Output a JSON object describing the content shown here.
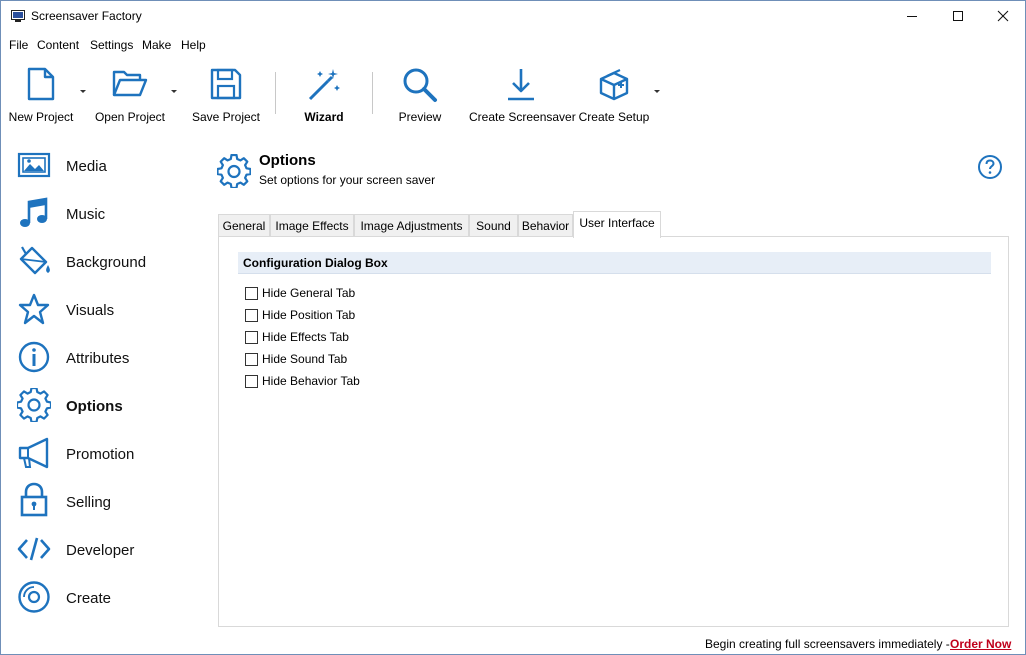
{
  "window": {
    "title": "Screensaver Factory"
  },
  "menu": [
    "File",
    "Content",
    "Settings",
    "Make",
    "Help"
  ],
  "toolbar": {
    "new_project": "New Project",
    "open_project": "Open Project",
    "save_project": "Save Project",
    "wizard": "Wizard",
    "preview": "Preview",
    "create_screensaver": "Create Screensaver",
    "create_setup": "Create Setup"
  },
  "sidebar": {
    "items": [
      {
        "label": "Media",
        "icon": "image-icon"
      },
      {
        "label": "Music",
        "icon": "music-note-icon"
      },
      {
        "label": "Background",
        "icon": "paint-bucket-icon"
      },
      {
        "label": "Visuals",
        "icon": "star-icon"
      },
      {
        "label": "Attributes",
        "icon": "info-icon"
      },
      {
        "label": "Options",
        "icon": "gear-icon",
        "active": true
      },
      {
        "label": "Promotion",
        "icon": "megaphone-icon"
      },
      {
        "label": "Selling",
        "icon": "lock-icon"
      },
      {
        "label": "Developer",
        "icon": "code-icon"
      },
      {
        "label": "Create",
        "icon": "disc-icon"
      }
    ]
  },
  "main": {
    "title": "Options",
    "subtitle": "Set options for your screen saver",
    "tabs": [
      "General",
      "Image Effects",
      "Image Adjustments",
      "Sound",
      "Behavior",
      "User Interface"
    ],
    "active_tab": "User Interface",
    "group_title": "Configuration Dialog Box",
    "checkboxes": [
      {
        "label": "Hide General Tab",
        "checked": false
      },
      {
        "label": "Hide Position Tab",
        "checked": false
      },
      {
        "label": "Hide Effects Tab",
        "checked": false
      },
      {
        "label": "Hide Sound Tab",
        "checked": false
      },
      {
        "label": "Hide Behavior Tab",
        "checked": false
      }
    ]
  },
  "footer": {
    "text": "Begin creating full screensavers immediately - ",
    "link": "Order Now"
  },
  "colors": {
    "accent": "#1e73be",
    "link": "#c0001b",
    "group_header": "#e7eef7"
  }
}
